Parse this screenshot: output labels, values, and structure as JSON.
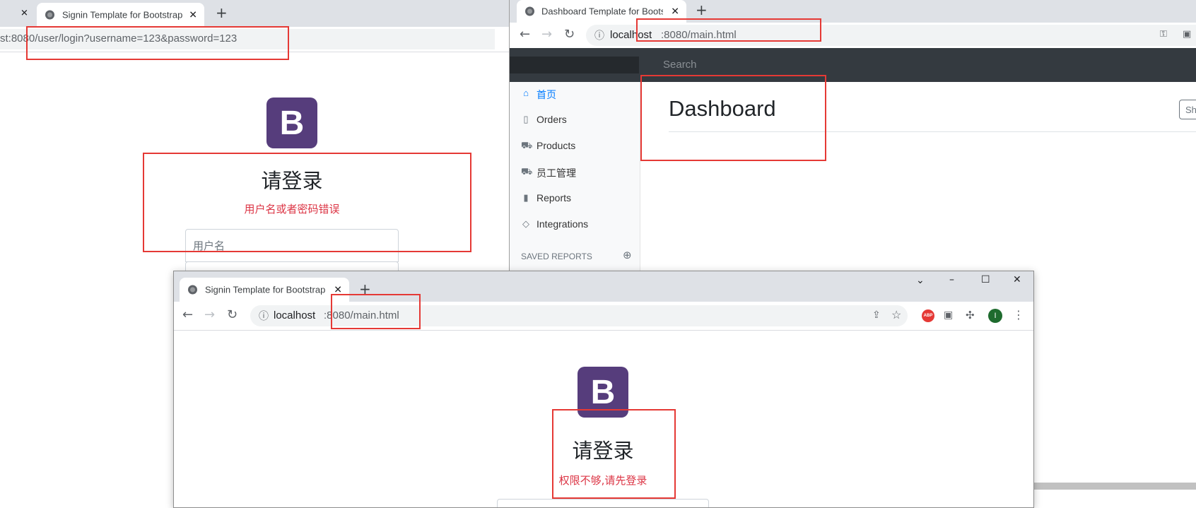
{
  "win1": {
    "tab_title": "Signin Template for Bootstrap",
    "prev_tab_close": "✕",
    "address": "st:8080/user/login?username=123&password=123",
    "logo_letter": "B",
    "heading": "请登录",
    "error": "用户名或者密码错误",
    "username_placeholder": "用户名"
  },
  "win2": {
    "tab_title": "Dashboard Template for Bootstrap",
    "address_host": "localhost",
    "address_rest": ":8080/main.html",
    "search_placeholder": "Search",
    "sidebar": [
      {
        "label": "首页",
        "icon": "home-icon",
        "glyph": "⌂",
        "active": true
      },
      {
        "label": "Orders",
        "icon": "file-icon",
        "glyph": "▯",
        "active": false
      },
      {
        "label": "Products",
        "icon": "cart-icon",
        "glyph": "⛟",
        "active": false
      },
      {
        "label": "员工管理",
        "icon": "cart-icon",
        "glyph": "⛟",
        "active": false
      },
      {
        "label": "Reports",
        "icon": "bar-chart-icon",
        "glyph": "▮",
        "active": false
      },
      {
        "label": "Integrations",
        "icon": "layers-icon",
        "glyph": "◇",
        "active": false
      }
    ],
    "saved_reports": "SAVED REPORTS",
    "page_title": "Dashboard",
    "share_button": "Sha",
    "active_color": "#007bff"
  },
  "win3": {
    "tab_title": "Signin Template for Bootstrap",
    "address_host": "localhost",
    "address_rest": ":8080/main.html",
    "extension_abp": "ABP",
    "profile_initial": "I",
    "logo_letter": "B",
    "heading": "请登录",
    "error": "权限不够,请先登录"
  }
}
